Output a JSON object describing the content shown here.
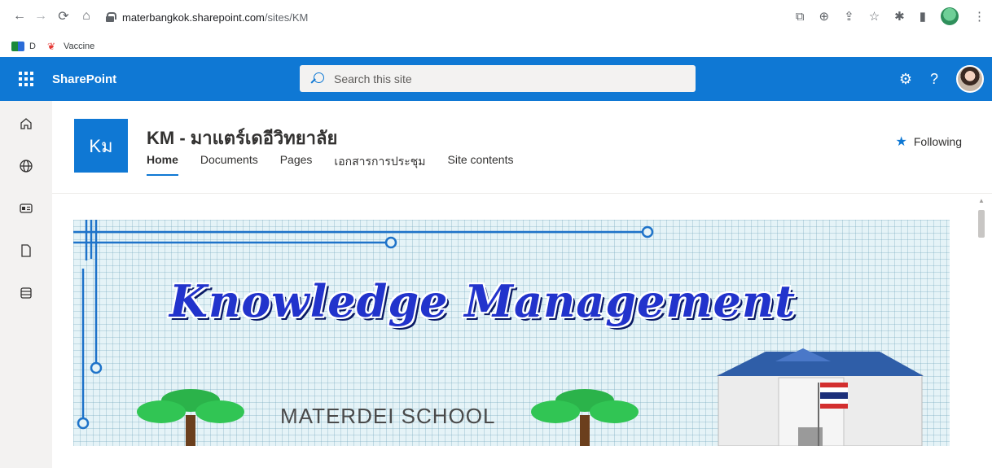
{
  "browser": {
    "url_host": "materbangkok.sharepoint.com",
    "url_path": "/sites/KM",
    "bookmarks": [
      {
        "label": "D"
      },
      {
        "label": "Vaccine"
      }
    ]
  },
  "suite": {
    "brand": "SharePoint",
    "search_placeholder": "Search this site"
  },
  "site": {
    "logo_text": "Kม",
    "title": "KM - มาแตร์เดอีวิทยาลัย",
    "nav": [
      "Home",
      "Documents",
      "Pages",
      "เอกสารการประชุม",
      "Site contents"
    ],
    "active_nav": "Home",
    "follow_label": "Following"
  },
  "banner": {
    "heading": "Knowledge Management",
    "subheading": "MATERDEI SCHOOL"
  },
  "icons": {
    "appbar": [
      "home-icon",
      "globe-icon",
      "news-icon",
      "file-icon",
      "list-icon"
    ]
  },
  "colors": {
    "brand_blue": "#0f78d4",
    "appbar_bg": "#f3f2f1"
  }
}
